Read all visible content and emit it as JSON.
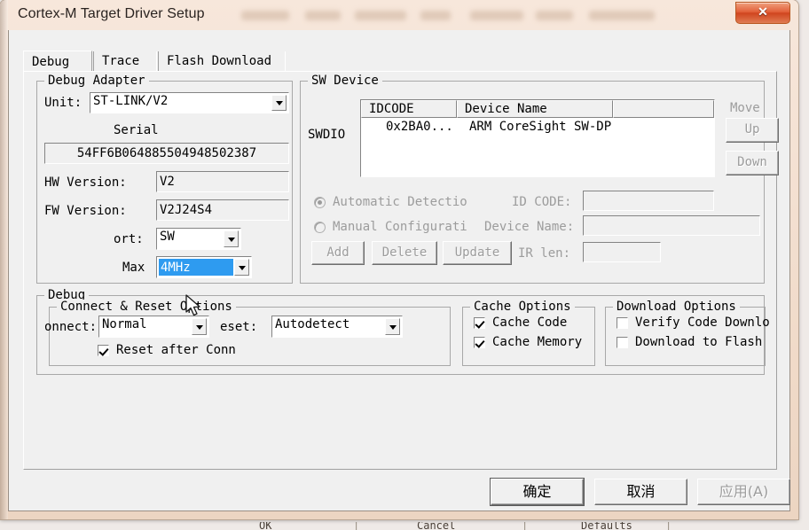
{
  "window": {
    "title": "Cortex-M Target Driver Setup",
    "close_label": "✕"
  },
  "tabs": [
    {
      "label": "Debug",
      "active": true
    },
    {
      "label": "Trace",
      "active": false
    },
    {
      "label": "Flash Download",
      "active": false
    }
  ],
  "debug_adapter": {
    "group_label": "Debug Adapter",
    "unit_label": "Unit:",
    "unit_value": "ST-LINK/V2",
    "serial_label": "Serial",
    "serial_value": "54FF6B064885504948502387",
    "hw_version_label": "HW Version:",
    "hw_version_value": "V2",
    "fw_version_label": "FW Version:",
    "fw_version_value": "V2J24S4",
    "port_label": "ort:",
    "port_value": "SW",
    "max_clock_label": "Max",
    "max_clock_value": "4MHz"
  },
  "sw_device": {
    "group_label": "SW Device",
    "swdio_label": "SWDIO",
    "columns": [
      "IDCODE",
      "Device Name",
      ""
    ],
    "rows": [
      {
        "idcode": "0x2BA0...",
        "device_name": "ARM CoreSight SW-DP"
      }
    ],
    "move_label": "Move",
    "up_label": "Up",
    "down_label": "Down",
    "automatic_detection_label": "Automatic Detectio",
    "manual_configuration_label": "Manual Configurati",
    "id_code_label": "ID CODE:",
    "id_code_value": "",
    "device_name_label": "Device Name:",
    "device_name_value": "",
    "ir_len_label": "IR len:",
    "ir_len_value": "",
    "add_label": "Add",
    "delete_label": "Delete",
    "update_label": "Update"
  },
  "debug_section": {
    "group_label": "Debug",
    "connect_reset": {
      "group_label": "Connect & Reset Options",
      "connect_label": "onnect:",
      "connect_value": "Normal",
      "reset_label": "eset:",
      "reset_value": "Autodetect",
      "reset_after_connect_label": "Reset after Conn",
      "reset_after_connect_checked": true
    },
    "cache_options": {
      "group_label": "Cache Options",
      "cache_code_label": "Cache Code",
      "cache_code_checked": true,
      "cache_memory_label": "Cache Memory",
      "cache_memory_checked": true
    },
    "download_options": {
      "group_label": "Download Options",
      "verify_code_label": "Verify Code Downlo",
      "verify_code_checked": false,
      "download_flash_label": "Download to Flash",
      "download_flash_checked": false
    }
  },
  "actions": {
    "ok_label": "确定",
    "cancel_label": "取消",
    "apply_label": "应用(A)"
  },
  "background_window": {
    "ok_label": "OK",
    "cancel_label": "Cancel",
    "defaults_label": "Defaults",
    "separator": "|"
  },
  "colors": {
    "selection_blue": "#2e9bf0",
    "dialog_face": "#f0f0f0",
    "title_beige": "#f3dfd0",
    "close_red": "#d0451f",
    "disabled_gray": "#9c9c9c"
  }
}
